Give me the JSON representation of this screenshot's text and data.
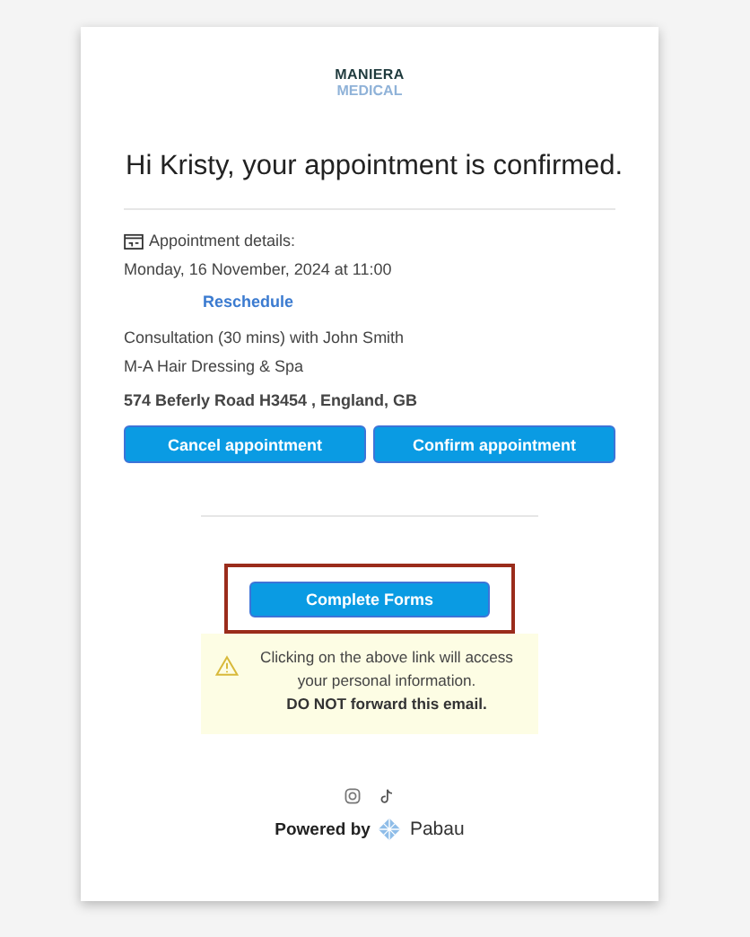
{
  "logo": {
    "line_1": "MANIERA",
    "line_2": "MEDICAL"
  },
  "heading": "Hi Kristy, your appointment is confirmed.",
  "details": {
    "label": "Appointment details:",
    "datetime": "Monday, 16 November, 2024 at 11:00",
    "reschedule": "Reschedule",
    "service": "Consultation (30 mins) with John Smith",
    "location": "M-A Hair Dressing & Spa",
    "address": "574 Beferly Road H3454 , England, GB"
  },
  "buttons": [
    "Cancel appointment",
    "Confirm appointment"
  ],
  "forms_button": {
    "label": "Complete Forms",
    "highlighted": true
  },
  "warning": {
    "line_1": "Clicking on the above link will access your personal information.",
    "line_2": "DO NOT forward this email."
  },
  "footer": {
    "powered_by": "Powered by",
    "brand": "Pabau"
  }
}
